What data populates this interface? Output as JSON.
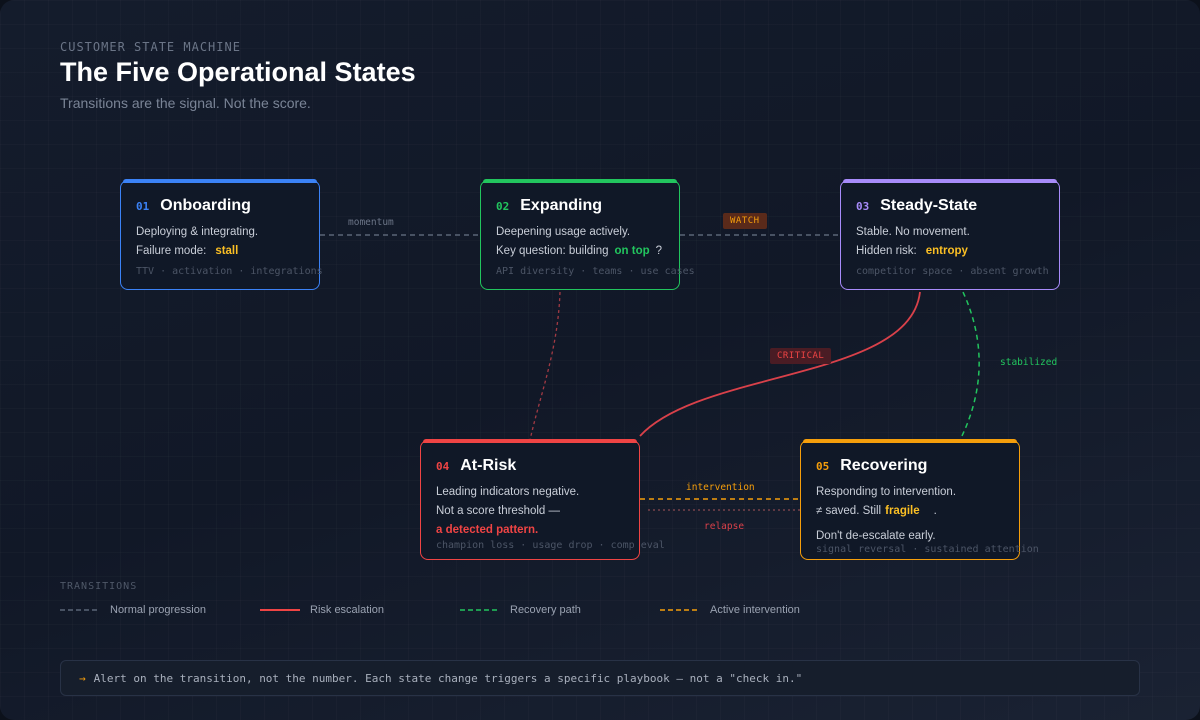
{
  "header": {
    "eyebrow": "CUSTOMER STATE MACHINE",
    "title": "The Five Operational States",
    "subtitle": "Transitions are the signal. Not the score."
  },
  "states": [
    {
      "num": "01",
      "name": "Onboarding",
      "line1": "Deploying & integrating.",
      "line2": "Failure mode:",
      "highlight": "stall",
      "meta": "TTV · activation · integrations",
      "color": "#3b82f6"
    },
    {
      "num": "02",
      "name": "Expanding",
      "line1": "Deepening usage actively.",
      "line2": "Key question: building",
      "highlight": "on top",
      "suffix": "?",
      "meta": "API diversity · teams · use cases",
      "color": "#22c55e"
    },
    {
      "num": "03",
      "name": "Steady-State",
      "line1": "Stable. No movement.",
      "line2": "Hidden risk:",
      "highlight": "entropy",
      "meta": "competitor space · absent growth",
      "color": "#a78bfa"
    },
    {
      "num": "04",
      "name": "At-Risk",
      "line1": "Leading indicators negative.",
      "line2": "Not a score threshold —",
      "highlight": "a detected pattern.",
      "meta": "champion loss · usage drop · comp eval",
      "color": "#ef4444"
    },
    {
      "num": "05",
      "name": "Recovering",
      "line1": "Responding to intervention.",
      "line2": "≠ saved. Still",
      "highlight": "fragile",
      "suffix": ".",
      "line3": "Don't de-escalate early.",
      "meta": "signal reversal · sustained attention",
      "color": "#f59e0b"
    }
  ],
  "edges": {
    "momentum": "momentum",
    "watch": "WATCH",
    "critical": "CRITICAL",
    "stabilized": "stabilized",
    "intervention": "intervention",
    "relapse": "relapse"
  },
  "legend": {
    "title": "TRANSITIONS",
    "items": [
      {
        "label": "Normal progression",
        "color": "#5b6577",
        "dashed": true
      },
      {
        "label": "Risk escalation",
        "color": "#ef4444",
        "dashed": false
      },
      {
        "label": "Recovery path",
        "color": "#22c55e",
        "dashed": true
      },
      {
        "label": "Active intervention",
        "color": "#f59e0b",
        "dashed": true
      }
    ]
  },
  "footer": {
    "arrow": "→",
    "text": "Alert on the transition, not the number.  Each state change triggers a specific playbook — not a \"check in.\""
  }
}
